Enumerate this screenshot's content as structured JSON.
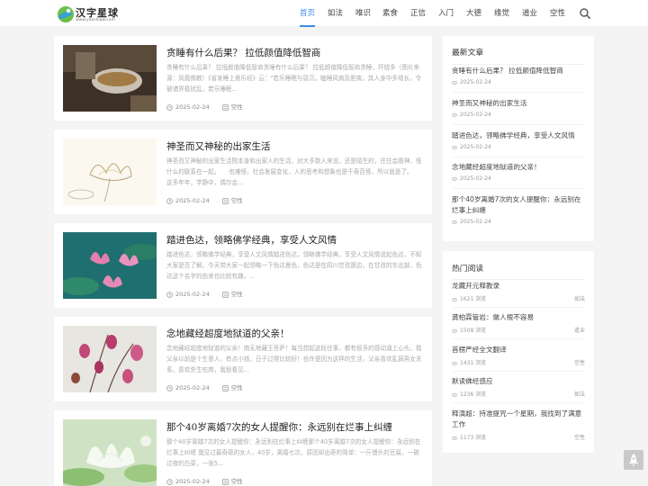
{
  "site": {
    "name": "汉字星球",
    "domain": "www.yaoshiqw.com"
  },
  "nav": {
    "items": [
      "首页",
      "如法",
      "唯识",
      "素食",
      "正信",
      "入门",
      "大德",
      "缘觉",
      "道业",
      "空性"
    ],
    "active": "首页"
  },
  "articles": [
    {
      "title": "贪睡有什么后果？ 拉低颜值降低智商",
      "excerpt": "贪睡有什么后果？ 拉低颜值降低智商贪睡有什么后果？ 拉低颜值降低智商贪睡，环绕多（图片来源：凤凰佛教）《省发睡上意乐经》云：\"若乐睡眠与昏沉，瞌睡风病及胆疾。其人身中多增长，令彼诸界极扰乱，若乐睡眠...",
      "date": "2025-02-24",
      "category": "空性",
      "image": "tea-bowl"
    },
    {
      "title": "神圣而又神秘的出家生活",
      "excerpt": "神圣而又神秘的出家生活院本身和出家人的生活，对大多数人来说，还是陌生的，往往会跟神、怪什么的联系在一起。　　也难怪，社会发展变化，人的思考和想象也是千奇百怪，所以就是了。　　这多年年，学静中，偶尔会...",
      "date": "2025-02-24",
      "category": "空性",
      "image": "lotus-sketch"
    },
    {
      "title": "踏进色达，领略佛学经典，享受人文风情",
      "excerpt": "踏进色达，领略佛学经典，享受人文风情踏进色达，领略佛学经典，享受人文风情说起色达，不知大家是否了解。今天带大家一起领略一下色达景色，色达是在四川甘孜那边，在甘孜的东北部，色达这个名字的由来也比较有趣，...",
      "date": "2025-02-24",
      "category": "空性",
      "image": "pink-lotus"
    },
    {
      "title": "念地藏经超度地狱道的父亲！",
      "excerpt": "念地藏经超度地狱道的父亲！南无地藏王菩萨！每当想起这段往事，都有很多的感动涌上心头。我父亲以前是个生意人，有点小钱，日子过得比较好！也许是因为这样的生活，父亲喜欢乱搞男女关系，喜欢杀生吃肉，我很看见...",
      "date": "2025-02-24",
      "category": "空性",
      "image": "pink-flowers"
    },
    {
      "title": "那个40岁离婚7次的女人提醒你：永远别在烂事上纠缠",
      "excerpt": "那个40岁离婚7次的女人提醒你：永远别在烂事上纠缠那个40岁离婚7次的女人提醒你：永远别在烂事上纠缠 我见过最奇葩的女人，40岁，离婚七次，原因却出奇的简单：一斤馒头的豆腐，一碗过夜的白菜，一张5...",
      "date": "2025-02-24",
      "category": "空性",
      "image": "white-lotus"
    }
  ],
  "latest": {
    "title": "最新文章",
    "items": [
      {
        "title": "贪睡有什么后果？ 拉低颜值降低智商",
        "date": "2025-02-24"
      },
      {
        "title": "神圣而又神秘的出家生活",
        "date": "2025-02-24"
      },
      {
        "title": "踏进色达，领略佛学经典，享受人文风情",
        "date": "2025-02-24"
      },
      {
        "title": "念地藏经超度地狱道的父亲！",
        "date": "2025-02-24"
      },
      {
        "title": "那个40岁离婚7次的女人提醒你：永远别在烂事上纠缠",
        "date": "2025-02-24"
      }
    ]
  },
  "popular": {
    "title": "热门阅读",
    "items": [
      {
        "title": "龙藏开元释教录",
        "views": "1621 浏览",
        "category": "如法"
      },
      {
        "title": "龚柏霖管岩：做人根不容易",
        "views": "1508 浏览",
        "category": "道业"
      },
      {
        "title": "首楞严经全文翻译",
        "views": "1431 浏览",
        "category": "空性"
      },
      {
        "title": "默读佛经感应",
        "views": "1236 浏览",
        "category": "如法"
      },
      {
        "title": "释演超：持准提咒一个星期，我找到了满意工作",
        "views": "1173 浏览",
        "category": "空性"
      }
    ]
  },
  "colors": {
    "accent": "#3a8ee6",
    "background": "#f4f4f5"
  }
}
